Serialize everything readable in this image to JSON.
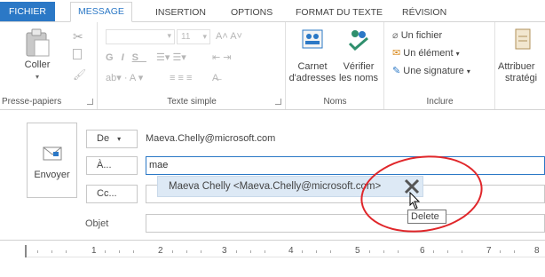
{
  "tabs": [
    {
      "label": "FICHIER"
    },
    {
      "label": "MESSAGE"
    },
    {
      "label": "INSERTION"
    },
    {
      "label": "OPTIONS"
    },
    {
      "label": "FORMAT DU TEXTE"
    },
    {
      "label": "RÉVISION"
    }
  ],
  "ribbon": {
    "clipboard": {
      "paste_label": "Coller",
      "group_label": "Presse-papiers"
    },
    "basic_text": {
      "font_size": "11",
      "group_label": "Texte simple"
    },
    "names": {
      "address_book_label_1": "Carnet",
      "address_book_label_2": "d'adresses",
      "check_names_label_1": "Vérifier",
      "check_names_label_2": "les noms",
      "group_label": "Noms"
    },
    "include": {
      "attach_file": "Un fichier",
      "attach_item": "Un élément",
      "signature": "Une signature",
      "group_label": "Inclure"
    },
    "tags": {
      "assign_label_1": "Attribuer",
      "assign_label_2": "stratégi"
    }
  },
  "compose": {
    "send_label": "Envoyer",
    "from_button": "De",
    "from_value": "Maeva.Chelly@microsoft.com",
    "to_button": "À...",
    "to_value": "mae",
    "cc_button": "Cc...",
    "subject_label": "Objet"
  },
  "autocomplete": {
    "suggestion": "Maeva Chelly <Maeva.Chelly@microsoft.com>",
    "tooltip": "Delete"
  },
  "ruler": {
    "numbers": [
      "1",
      "2",
      "3",
      "4",
      "5",
      "6",
      "7",
      "8"
    ]
  },
  "colors": {
    "accent": "#2b78c6",
    "highlight": "#dde9f5",
    "annotation": "#e0262a"
  }
}
